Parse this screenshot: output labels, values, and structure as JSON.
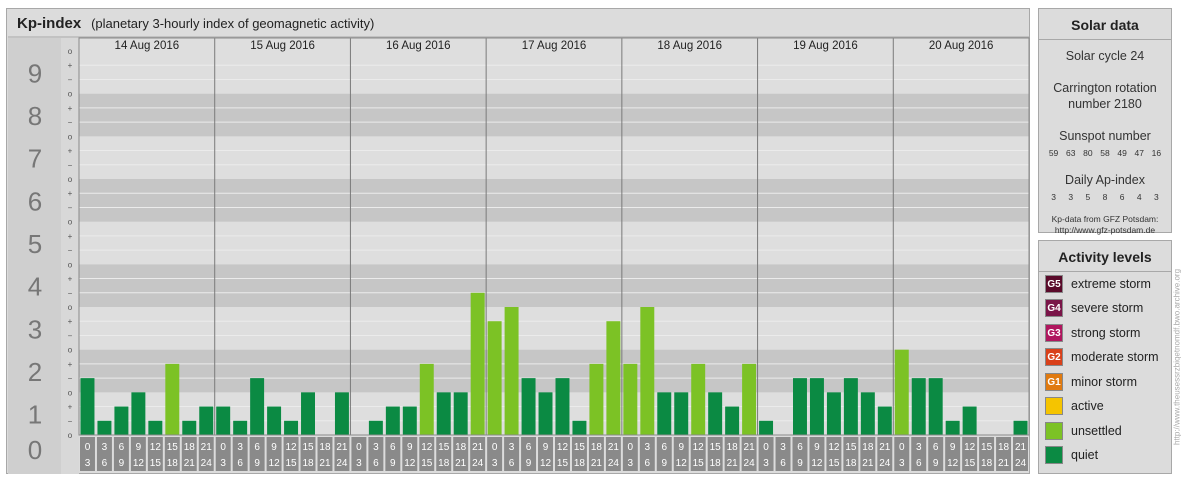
{
  "header": {
    "title": "Kp-index",
    "subtitle": "(planetary 3-hourly index of geomagnetic activity)"
  },
  "chart_data": {
    "type": "bar",
    "title": "Kp-index",
    "subtitle": "(planetary 3-hourly index of geomagnetic activity)",
    "ylim": [
      0,
      9
    ],
    "y_ticks": [
      "0",
      "1",
      "2",
      "3",
      "4",
      "5",
      "6",
      "7",
      "8",
      "9"
    ],
    "y_minor_ticks": [
      "o",
      "+",
      "−"
    ],
    "days": [
      "14 Aug 2016",
      "15 Aug 2016",
      "16 Aug 2016",
      "17 Aug 2016",
      "18 Aug 2016",
      "19 Aug 2016",
      "20 Aug 2016"
    ],
    "interval_labels": [
      [
        "0",
        "3"
      ],
      [
        "3",
        "6"
      ],
      [
        "6",
        "9"
      ],
      [
        "9",
        "12"
      ],
      [
        "12",
        "15"
      ],
      [
        "15",
        "18"
      ],
      [
        "18",
        "21"
      ],
      [
        "21",
        "24"
      ]
    ],
    "values": [
      [
        1.333,
        0.333,
        0.667,
        1.0,
        0.333,
        1.667,
        0.333,
        0.667
      ],
      [
        0.667,
        0.333,
        1.333,
        0.667,
        0.333,
        1.0,
        0.0,
        1.0
      ],
      [
        0.0,
        0.333,
        0.667,
        0.667,
        1.667,
        1.0,
        1.0,
        3.333
      ],
      [
        2.667,
        3.0,
        1.333,
        1.0,
        1.333,
        0.333,
        1.667,
        2.667
      ],
      [
        1.667,
        3.0,
        1.0,
        1.0,
        1.667,
        1.0,
        0.667,
        1.667
      ],
      [
        0.333,
        0.0,
        1.333,
        1.333,
        1.0,
        1.333,
        1.0,
        0.667
      ],
      [
        2.0,
        1.333,
        1.333,
        0.333,
        0.667,
        0.0,
        0.0,
        0.333
      ]
    ],
    "color_rule": "quiet below 1.667, unsettled from 1.667",
    "grid": true
  },
  "solar": {
    "title": "Solar data",
    "cycle": "Solar cycle 24",
    "carrington_line1": "Carrington rotation",
    "carrington_line2": "number 2180",
    "sunspot_title": "Sunspot number",
    "sunspot_values": [
      "59",
      "63",
      "80",
      "58",
      "49",
      "47",
      "16"
    ],
    "ap_title": "Daily Ap-index",
    "ap_values": [
      "3",
      "3",
      "5",
      "8",
      "6",
      "4",
      "3"
    ],
    "source_line1": "Kp-data from GFZ Potsdam:",
    "source_line2": "http://www.gfz-potsdam.de"
  },
  "activity": {
    "title": "Activity levels",
    "levels": [
      {
        "code": "G5",
        "label": "extreme storm",
        "color": "#5a0a2a"
      },
      {
        "code": "G4",
        "label": "severe storm",
        "color": "#7a1448"
      },
      {
        "code": "G3",
        "label": "strong storm",
        "color": "#b0165e"
      },
      {
        "code": "G2",
        "label": "moderate storm",
        "color": "#d9401a"
      },
      {
        "code": "G1",
        "label": "minor storm",
        "color": "#e07a10"
      },
      {
        "code": "",
        "label": "active",
        "color": "#f5c400"
      },
      {
        "code": "",
        "label": "unsettled",
        "color": "#7cc225"
      },
      {
        "code": "",
        "label": "quiet",
        "color": "#0b8a43"
      }
    ]
  },
  "watermark": "http://www.theusessrzbiqetnomdf.bwo.archive.org",
  "colors": {
    "quiet": "#0b8a43",
    "unsettled": "#7cc225",
    "band_dark": "#c6c6c6",
    "band_light": "#dedede",
    "axis_gray": "#8a8a8a"
  }
}
